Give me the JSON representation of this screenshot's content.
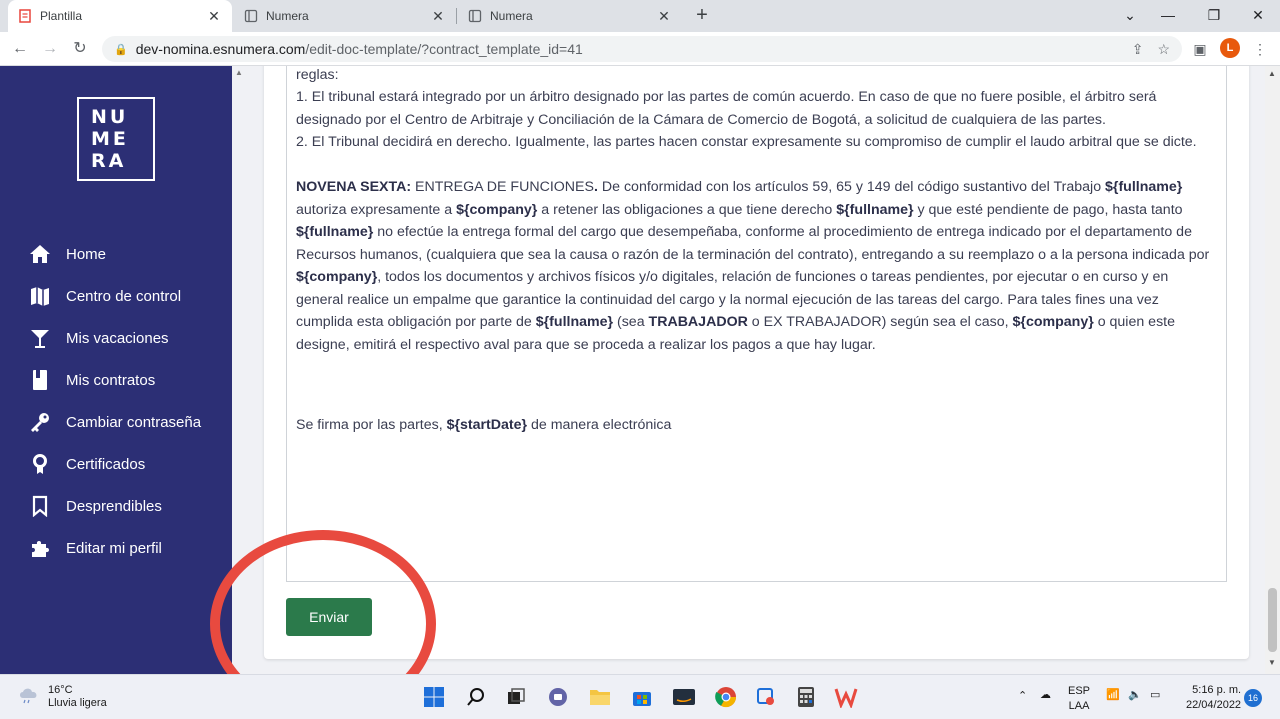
{
  "browser": {
    "tabs": [
      {
        "title": "Plantilla",
        "active": true
      },
      {
        "title": "Numera",
        "active": false
      },
      {
        "title": "Numera",
        "active": false
      }
    ],
    "url_host": "dev-nomina.esnumera.com",
    "url_path": "/edit-doc-template/?contract_template_id=41",
    "profile_initial": "L"
  },
  "sidebar": {
    "logo_lines": [
      "NU",
      "ME",
      "RA"
    ],
    "items": [
      {
        "label": "Home",
        "icon": "home-icon"
      },
      {
        "label": "Centro de control",
        "icon": "map-icon"
      },
      {
        "label": "Mis vacaciones",
        "icon": "cocktail-icon"
      },
      {
        "label": "Mis contratos",
        "icon": "contract-icon"
      },
      {
        "label": "Cambiar contraseña",
        "icon": "key-icon"
      },
      {
        "label": "Certificados",
        "icon": "certificate-icon"
      },
      {
        "label": "Desprendibles",
        "icon": "bookmark-icon"
      },
      {
        "label": "Editar mi perfil",
        "icon": "puzzle-icon"
      }
    ]
  },
  "document": {
    "p0": "Dicho Tribunal se sujetará al reglamento del Centro de Arbitraje y Conciliación de la Cámara de Comercio de Bogotá, de acuerdo a las siguientes reglas:",
    "p1": "1. El tribunal estará integrado por un árbitro designado por las partes de común acuerdo. En caso de que no fuere posible, el árbitro será designado por el Centro de Arbitraje y Conciliación de la Cámara de Comercio de Bogotá, a solicitud de cualquiera de las partes.",
    "p2": "2. El Tribunal decidirá en derecho. Igualmente, las partes hacen constar expresamente su compromiso de cumplir el laudo arbitral que se dicte.",
    "clause": {
      "heading": "NOVENA SEXTA:",
      "t1": " ENTREGA DE FUNCIONES",
      "dot": ".",
      "t2": " De conformidad con los artículos 59, 65 y 149 del código sustantivo del Trabajo ",
      "v1": "${fullname}",
      "t3": " autoriza expresamente a ",
      "v2": "${company}",
      "t4": " a retener las obligaciones a que tiene derecho ",
      "v3": "${fullname}",
      "t5": " y que esté pendiente de pago, hasta tanto ",
      "v4": "${fullname}",
      "t6": " no efectúe la entrega formal del cargo que desempeñaba, conforme al procedimiento de entrega indicado por el departamento de Recursos humanos, (cualquiera que sea la causa o razón de la terminación del contrato), entregando a su reemplazo o a la persona indicada por ",
      "v5": "${company}",
      "t7": ",  todos los documentos y archivos físicos y/o digitales, relación de funciones o tareas pendientes,  por ejecutar o en curso y en general realice un empalme que garantice la continuidad del  cargo y la normal ejecución de las tareas del cargo. Para tales fines una vez cumplida esta obligación por parte de ",
      "v6": "${fullname}",
      "t8": " (sea ",
      "v7": "TRABAJADOR",
      "t9": " o EX TRABAJADOR) según sea el caso,  ",
      "v8": "${company}",
      "t10": " o quien este designe, emitirá el respectivo aval para que se proceda a realizar los pagos a que hay lugar."
    },
    "signature": {
      "t1": "Se firma por las partes, ",
      "v1": "${startDate}",
      "t2": " de manera electrónica"
    }
  },
  "actions": {
    "send_label": "Enviar"
  },
  "taskbar": {
    "temp": "16°C",
    "weather": "Lluvia ligera",
    "lang1": "ESP",
    "lang2": "LAA",
    "time": "5:16 p. m.",
    "date": "22/04/2022",
    "notifications": "16"
  },
  "colors": {
    "sidebar": "#2c2f75",
    "send_button": "#2b7a4b",
    "highlight_circle": "#e84a3f"
  }
}
